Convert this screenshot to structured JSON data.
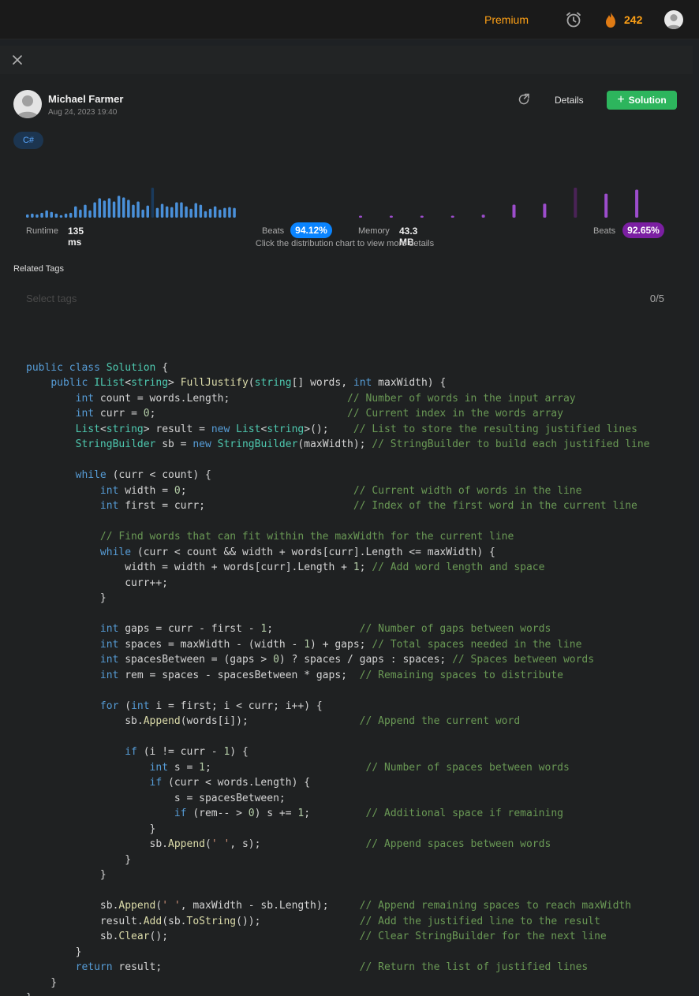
{
  "header": {
    "premium_label": "Premium",
    "streak_count": "242",
    "icons": [
      "alarm-clock-icon",
      "fire-icon",
      "user-avatar"
    ],
    "accent_color": "#ffa116"
  },
  "solution": {
    "author": "Michael Farmer",
    "date": "Aug 24, 2023 19:40",
    "details_label": "Details",
    "solution_button_label": "Solution",
    "language_tag": "C#"
  },
  "stats": {
    "runtime_label": "Runtime",
    "runtime_value": "135 ms",
    "runtime_beats_label": "Beats",
    "runtime_beats": "94.12%",
    "memory_label": "Memory",
    "memory_value": "43.3 MB",
    "memory_beats_label": "Beats",
    "memory_beats": "92.65%",
    "hint": "Click the distribution chart to view more details",
    "runtime_color": "#0a84ff",
    "memory_color": "#7b1fa2"
  },
  "chart_data": [
    {
      "type": "bar",
      "name": "runtime-distribution",
      "values": [
        4,
        5,
        4,
        6,
        9,
        7,
        5,
        3,
        5,
        6,
        14,
        10,
        16,
        9,
        19,
        24,
        21,
        24,
        20,
        27,
        25,
        22,
        16,
        20,
        10,
        15,
        37,
        12,
        17,
        14,
        13,
        19,
        19,
        14,
        11,
        18,
        16,
        8,
        11,
        14,
        10,
        12,
        13,
        12
      ],
      "highlight_index": 26,
      "color": "#4a90d9",
      "highlight_color": "#1a3a5c"
    },
    {
      "type": "bar",
      "name": "memory-distribution",
      "values": [
        2,
        2,
        2,
        2,
        3,
        13,
        14,
        30,
        24,
        28
      ],
      "highlight_index": 7,
      "color": "#9c4dcc",
      "highlight_color": "#4a2357"
    }
  ],
  "related_tags": {
    "title": "Related Tags",
    "placeholder": "Select tags",
    "count": "0/5"
  },
  "code_lines": [
    "",
    "public class Solution {",
    "    public IList<string> FullJustify(string[] words, int maxWidth) {",
    "        int count = words.Length;                   // Number of words in the input array",
    "        int curr = 0;                               // Current index in the words array",
    "        List<string> result = new List<string>();    // List to store the resulting justified lines",
    "        StringBuilder sb = new StringBuilder(maxWidth); // StringBuilder to build each justified line",
    "",
    "        while (curr < count) {",
    "            int width = 0;                           // Current width of words in the line",
    "            int first = curr;                        // Index of the first word in the current line",
    "",
    "            // Find words that can fit within the maxWidth for the current line",
    "            while (curr < count && width + words[curr].Length <= maxWidth) {",
    "                width = width + words[curr].Length + 1; // Add word length and space",
    "                curr++;",
    "            }",
    "",
    "            int gaps = curr - first - 1;              // Number of gaps between words",
    "            int spaces = maxWidth - (width - 1) + gaps; // Total spaces needed in the line",
    "            int spacesBetween = (gaps > 0) ? spaces / gaps : spaces; // Spaces between words",
    "            int rem = spaces - spacesBetween * gaps;  // Remaining spaces to distribute",
    "",
    "            for (int i = first; i < curr; i++) {",
    "                sb.Append(words[i]);                  // Append the current word",
    "",
    "                if (i != curr - 1) {",
    "                    int s = 1;                         // Number of spaces between words",
    "                    if (curr < words.Length) {",
    "                        s = spacesBetween;",
    "                        if (rem-- > 0) s += 1;         // Additional space if remaining",
    "                    }",
    "                    sb.Append(' ', s);                 // Append spaces between words",
    "                }",
    "            }",
    "",
    "            sb.Append(' ', maxWidth - sb.Length);     // Append remaining spaces to reach maxWidth",
    "            result.Add(sb.ToString());                // Add the justified line to the result",
    "            sb.Clear();                               // Clear StringBuilder for the next line",
    "        }",
    "        return result;                                // Return the list of justified lines",
    "    }",
    "}"
  ]
}
